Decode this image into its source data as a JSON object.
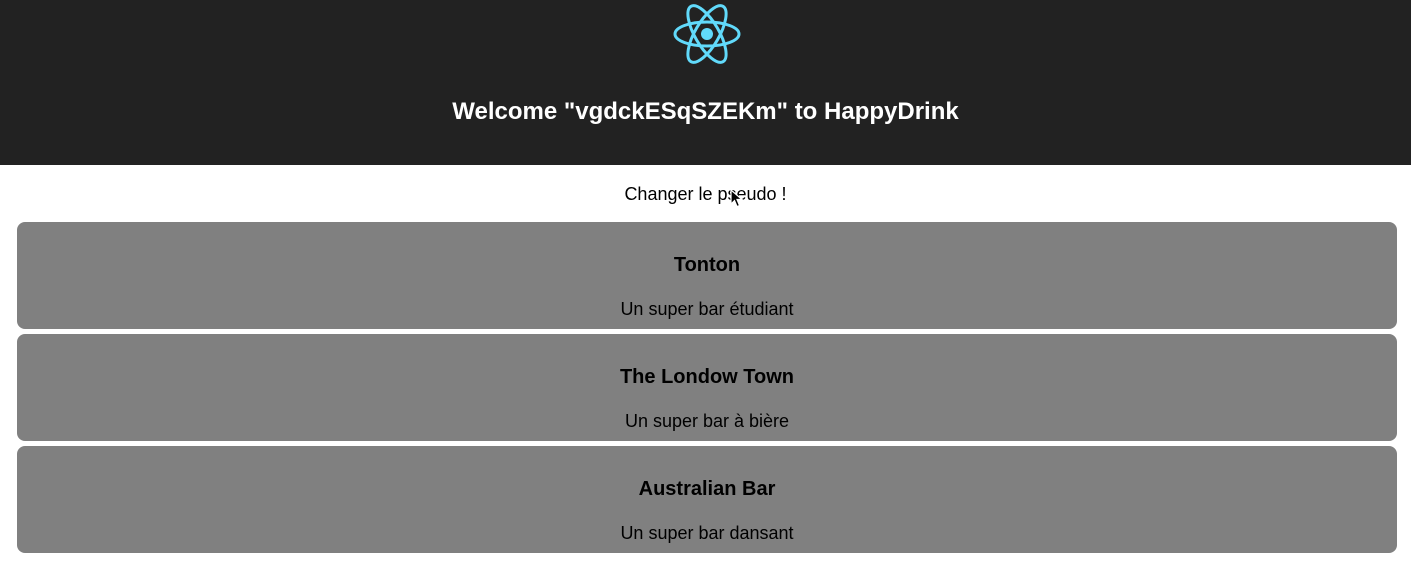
{
  "header": {
    "logo_icon": "react-logo-icon",
    "logo_color": "#61dafb",
    "background": "#222222",
    "welcome": "Welcome \"vgdckESqSZEKm\" to HappyDrink"
  },
  "change_pseudo": {
    "label": "Changer le pseudo !"
  },
  "bars": [
    {
      "name": "Tonton",
      "description": "Un super bar étudiant"
    },
    {
      "name": "The Londow Town",
      "description": "Un super bar à bière"
    },
    {
      "name": "Australian Bar",
      "description": "Un super bar dansant"
    }
  ],
  "card_color": "#808080"
}
